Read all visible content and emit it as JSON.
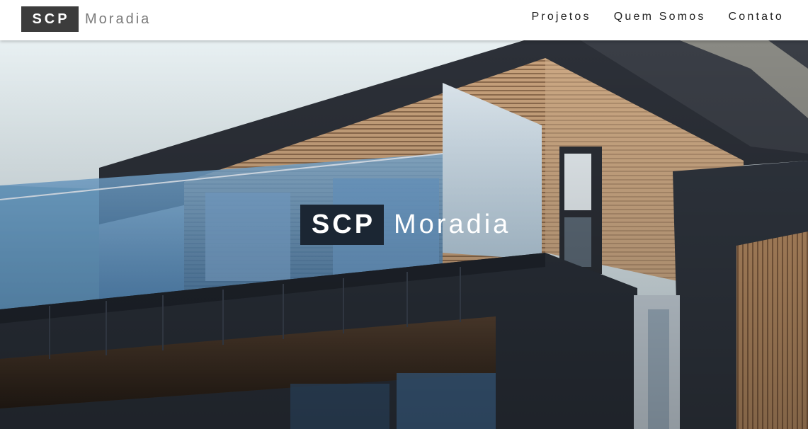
{
  "brand": {
    "abbr": "SCP",
    "name": "Moradia"
  },
  "nav": {
    "items": [
      {
        "label": "Projetos"
      },
      {
        "label": "Quem Somos"
      },
      {
        "label": "Contato"
      }
    ]
  },
  "hero": {
    "abbr": "SCP",
    "name": "Moradia"
  },
  "colors": {
    "brand_box": "#3c3c3c",
    "brand_text": "#7a7a7a",
    "hero_box": "#1b2633",
    "hero_text": "#ffffff"
  }
}
